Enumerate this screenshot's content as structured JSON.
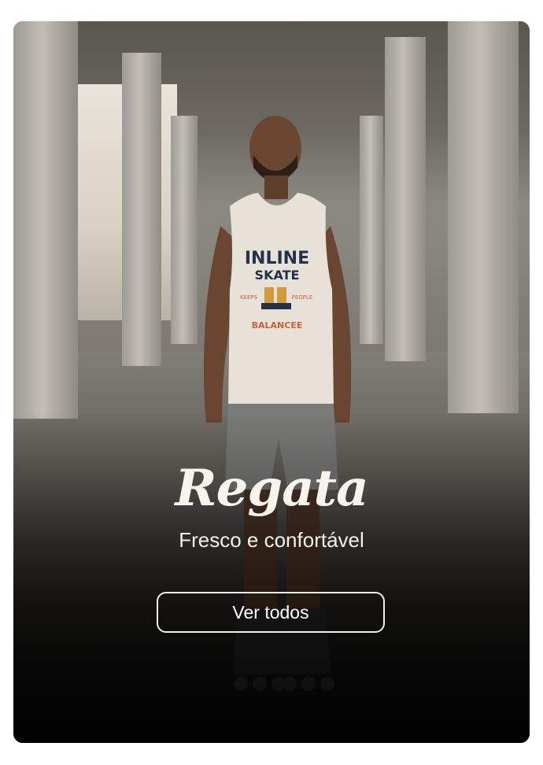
{
  "banner": {
    "title": "Regata",
    "subtitle": "Fresco e confortável",
    "cta_label": "Ver todos",
    "shirt_print": {
      "line1": "INLINE",
      "line2": "SKATE",
      "left_small": "KEEPS",
      "right_small": "PEOPLE",
      "bottom": "BALANCEE"
    }
  },
  "colors": {
    "text": "#f7f4ee",
    "button_border": "#f2f0ea",
    "card_bottom": "#070707"
  }
}
